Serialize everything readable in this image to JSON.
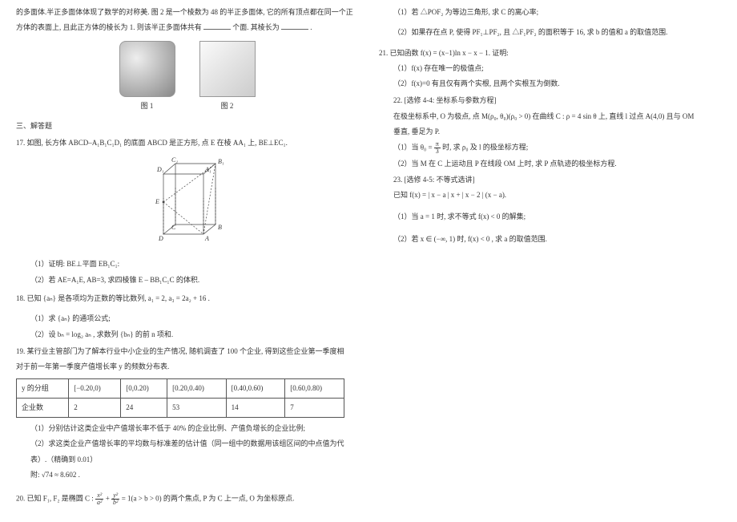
{
  "pageno": "",
  "left": {
    "intro_l1": "的多面体.半正多面体体现了数学的对称美. 图 2 是一个棱数为 48 的半正多面体, 它的所有顶点都在同一个正",
    "intro_l2_a": "方体的表面上, 且此正方体的棱长为 1. 则该半正多面体共有",
    "intro_l2_b": "个面. 其棱长为",
    "intro_l2_c": ".",
    "fig1_label": "图 1",
    "fig2_label": "图 2",
    "section3": "三、解答题",
    "q17_a": "17.  如图, 长方体 ABCD–A₁B₁C₁D₁ 的底面 ABCD 是正方形, 点 E 在棱 AA₁ 上, BE⊥EC₁.",
    "q17_1": "（1）证明: BE⊥平面 EB₁C₁:",
    "q17_2": "（2）若 AE=A₁E,  AB=3, 求四棱锥 E – BB₁C₁C 的体积.",
    "q18_a": "18.  已知 {aₙ} 是各项均为正数的等比数列,  a₁ = 2, a₃ = 2a₂ + 16 .",
    "q18_1": "（1）求 {aₙ} 的通项公式;",
    "q18_2": "（2）设 bₙ = log₂ aₙ , 求数列 {bₙ} 的前 n 项和.",
    "q19_a": "19.  某行业主管部门为了解本行业中小企业的生产情况, 随机调查了 100 个企业, 得到这些企业第一季度相",
    "q19_b": "对于前一年第一季度产值增长率 y 的频数分布表.",
    "table": {
      "head": [
        "y 的分组",
        "[−0.20,0)",
        "[0,0.20)",
        "[0.20,0.40)",
        "[0.40,0.60)",
        "[0.60,0.80)"
      ],
      "row2_label": "企业数",
      "row2": [
        "2",
        "24",
        "53",
        "14",
        "7"
      ]
    },
    "q19_1": "（1）分别估计这类企业中产值增长率不低于 40% 的企业比例、产值负增长的企业比例;",
    "q19_2a": "（2）求这类企业产值增长率的平均数与标准差的估计值（同一组中的数据用该组区间的中点值为代",
    "q19_2b": "表）.（精确到 0.01）",
    "q19_note": "附: √74 ≈ 8.602 .",
    "q20_a": "20.  已知 F₁, F₂ 是椭圆 C :",
    "q20_eq_numL": "x²",
    "q20_eq_denL": "a²",
    "q20_eq_plus": " + ",
    "q20_eq_numR": "y²",
    "q20_eq_denR": "b²",
    "q20_eq_tail": " = 1(a > b > 0) 的两个焦点, P 为 C 上一点, O 为坐标原点."
  },
  "right": {
    "q20_1": "（1）若 △POF₂ 为等边三角形, 求 C 的离心率;",
    "q20_2": "（2）如果存在点 P, 使得 PF₁⊥PF₂, 且 △F₁PF₂ 的面积等于 16, 求 b 的值和 a 的取值范围.",
    "q21_a": "21.  已知函数 f(x) = (x−1)ln x − x − 1. 证明:",
    "q21_1": "（1）f(x) 存在唯一的极值点;",
    "q21_2": "（2）f(x)=0 有且仅有两个实根, 且两个实根互为倒数.",
    "q22_a": "22.  [选修 4-4: 坐标系与参数方程]",
    "q22_b": "在极坐标系中, O 为极点, 点 M(ρ₀, θ₀)(ρ₀ > 0) 在曲线 C : ρ = 4 sin θ 上, 直线 l 过点 A(4,0) 且与 OM",
    "q22_c": "垂直, 垂足为 P.",
    "q22_1a": "（1）当 θ₀ = ",
    "q22_1_num": "π",
    "q22_1_den": "3",
    "q22_1b": " 时, 求 ρ₀ 及 l 的极坐标方程;",
    "q22_2": "（2）当 M 在 C 上运动且 P 在线段 OM 上时, 求 P 点轨迹的极坐标方程.",
    "q23_a": "23.  [选修 4-5: 不等式选讲]",
    "q23_b": "已知 f(x) = | x − a | x + | x − 2 | (x − a).",
    "q23_1": "（1）当 a = 1 时, 求不等式 f(x) < 0 的解集;",
    "q23_2": "（2）若 x ∈ (−∞, 1) 时,  f(x) < 0 , 求 a 的取值范围."
  }
}
